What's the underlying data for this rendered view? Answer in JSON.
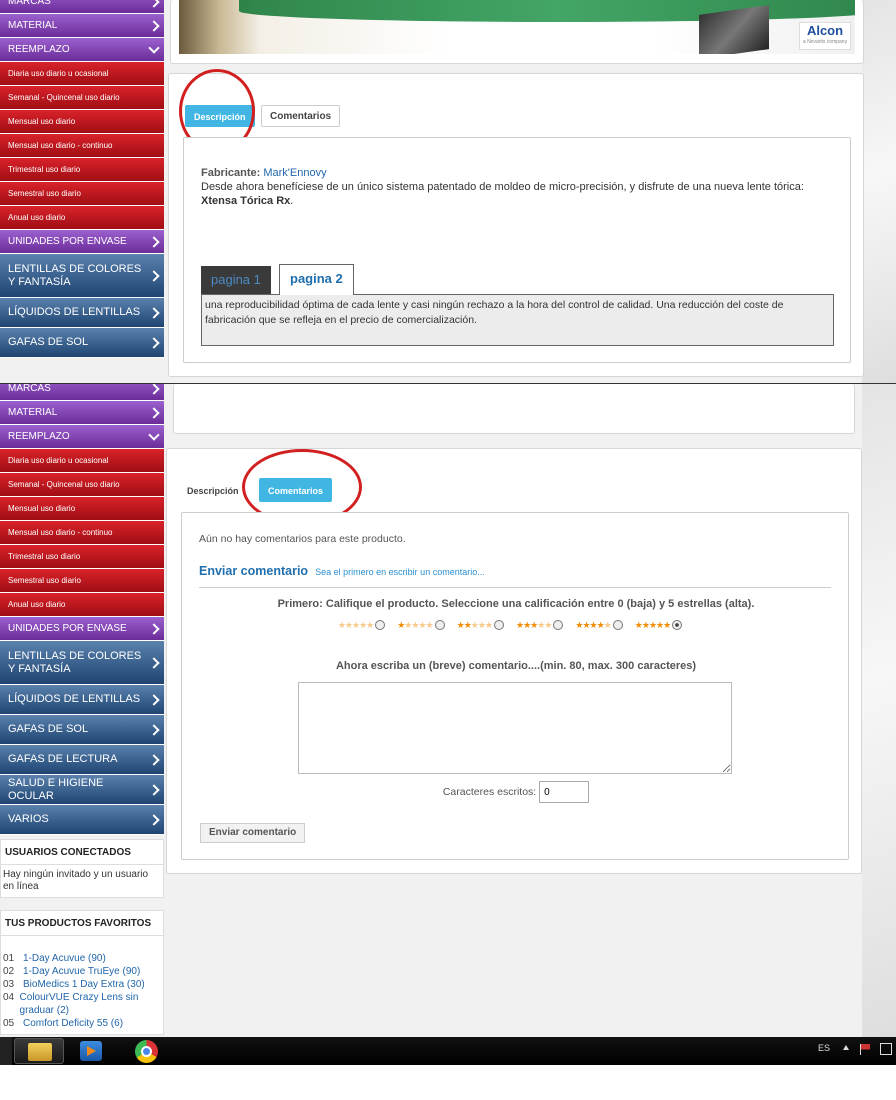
{
  "sidebar_top": {
    "items": [
      {
        "label": "MARCAS",
        "color": "purple"
      },
      {
        "label": "MATERIAL",
        "color": "purple"
      },
      {
        "label": "REEMPLAZO",
        "color": "purple",
        "expanded": true
      },
      {
        "label": "Diaria uso diario u ocasional",
        "color": "red"
      },
      {
        "label": "Semanal - Quincenal uso diario",
        "color": "red"
      },
      {
        "label": "Mensual uso diario",
        "color": "red"
      },
      {
        "label": "Mensual uso diario - continuo",
        "color": "red"
      },
      {
        "label": "Trimestral uso diario",
        "color": "red"
      },
      {
        "label": "Semestral uso diario",
        "color": "red"
      },
      {
        "label": "Anual uso diario",
        "color": "red"
      },
      {
        "label": "UNIDADES POR ENVASE",
        "color": "purple"
      },
      {
        "label": "LENTILLAS DE COLORES Y FANTASÍA",
        "color": "blue",
        "tall": true
      },
      {
        "label": "LÍQUIDOS DE LENTILLAS",
        "color": "blue"
      },
      {
        "label": "GAFAS DE SOL",
        "color": "blue"
      }
    ]
  },
  "sidebar_bottom": {
    "items": [
      {
        "label": "MARCAS",
        "color": "purple"
      },
      {
        "label": "MATERIAL",
        "color": "purple"
      },
      {
        "label": "REEMPLAZO",
        "color": "purple",
        "expanded": true
      },
      {
        "label": "Diaria uso diario u ocasional",
        "color": "red"
      },
      {
        "label": "Semanal - Quincenal uso diario",
        "color": "red"
      },
      {
        "label": "Mensual uso diario",
        "color": "red"
      },
      {
        "label": "Mensual uso diario - continuo",
        "color": "red"
      },
      {
        "label": "Trimestral uso diario",
        "color": "red"
      },
      {
        "label": "Semestral uso diario",
        "color": "red"
      },
      {
        "label": "Anual uso diario",
        "color": "red"
      },
      {
        "label": "UNIDADES POR ENVASE",
        "color": "purple"
      },
      {
        "label": "LENTILLAS DE COLORES Y FANTASÍA",
        "color": "blue",
        "tall": true
      },
      {
        "label": "LÍQUIDOS DE LENTILLAS",
        "color": "blue"
      },
      {
        "label": "GAFAS DE SOL",
        "color": "blue"
      },
      {
        "label": "GAFAS DE LECTURA",
        "color": "blue"
      },
      {
        "label": "SALUD E HIGIENE OCULAR",
        "color": "blue"
      },
      {
        "label": "VARIOS",
        "color": "blue"
      }
    ],
    "usuarios_title": "USUARIOS CONECTADOS",
    "usuarios_text": "Hay ningún invitado y un usuario en línea",
    "favoritos_title": "TUS PRODUCTOS FAVORITOS",
    "favoritos": [
      {
        "num": "01",
        "name": "1-Day Acuvue (90)"
      },
      {
        "num": "02",
        "name": "1-Day Acuvue TruEye (90)"
      },
      {
        "num": "03",
        "name": "BioMedics 1 Day Extra (30)"
      },
      {
        "num": "04",
        "name": "ColourVUE Crazy Lens sin graduar (2)"
      },
      {
        "num": "05",
        "name": "Comfort Deficity 55 (6)"
      }
    ]
  },
  "banner": {
    "logo": "Alcon",
    "logo_sub": "a Novartis company"
  },
  "top_tabs": {
    "descripcion": "Descripción",
    "comentarios": "Comentarios"
  },
  "description": {
    "fabricante_label": "Fabricante:",
    "fabricante_value": "Mark'Ennovy",
    "text": "Desde ahora benefíciese de un único sistema patentado de moldeo de micro-precisión, y disfrute de una nueva lente tórica:",
    "product": "Xtensa Tórica Rx",
    "pagina1": "pagina 1",
    "pagina2": "pagina 2",
    "page2_text": "una reproducibilidad óptima de cada lente y casi ningún rechazo a la hora del control de calidad. Una reducción del coste de fabricación que se refleja en el precio de comercialización."
  },
  "bottom_tabs": {
    "descripcion": "Descripción",
    "comentarios": "Comentarios"
  },
  "comments": {
    "none": "Aún no hay comentarios para este producto.",
    "enviar_title": "Enviar comentario",
    "enviar_sub": "Sea el primero en escribir un comentario...",
    "rate_prompt": "Primero: Califique el producto. Seleccione una calificación entre 0 (baja) y 5 estrellas (alta).",
    "ratings": [
      0,
      1,
      2,
      3,
      4,
      5
    ],
    "selected_rating": 5,
    "write_prompt": "Ahora escriba un (breve) comentario....(min. 80, max. 300 caracteres)",
    "chars_label": "Caracteres escritos:",
    "chars_value": "0",
    "submit": "Enviar comentario"
  },
  "taskbar": {
    "lang": "ES"
  },
  "colors": {
    "purple": "#7d3fb0",
    "red": "#c0161c",
    "blue": "#2f5a8a",
    "tab_active": "#42b6e3",
    "circle": "#d21f1f",
    "link": "#2266aa"
  }
}
